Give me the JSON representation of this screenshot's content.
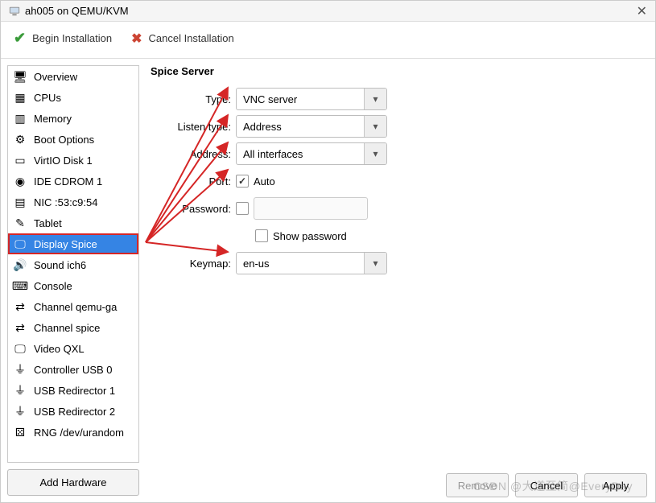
{
  "window": {
    "title": "ah005 on QEMU/KVM"
  },
  "toolbar": {
    "begin_label": "Begin Installation",
    "cancel_label": "Cancel Installation"
  },
  "sidebar": {
    "items": [
      {
        "label": "Overview",
        "icon": "monitor-icon"
      },
      {
        "label": "CPUs",
        "icon": "cpu-icon"
      },
      {
        "label": "Memory",
        "icon": "memory-icon"
      },
      {
        "label": "Boot Options",
        "icon": "boot-icon"
      },
      {
        "label": "VirtIO Disk 1",
        "icon": "disk-icon"
      },
      {
        "label": "IDE CDROM 1",
        "icon": "cdrom-icon"
      },
      {
        "label": "NIC :53:c9:54",
        "icon": "nic-icon"
      },
      {
        "label": "Tablet",
        "icon": "tablet-icon"
      },
      {
        "label": "Display Spice",
        "icon": "display-icon",
        "selected": true
      },
      {
        "label": "Sound ich6",
        "icon": "sound-icon"
      },
      {
        "label": "Console",
        "icon": "console-icon"
      },
      {
        "label": "Channel qemu-ga",
        "icon": "channel-icon"
      },
      {
        "label": "Channel spice",
        "icon": "channel-icon"
      },
      {
        "label": "Video QXL",
        "icon": "video-icon"
      },
      {
        "label": "Controller USB 0",
        "icon": "usb-controller-icon"
      },
      {
        "label": "USB Redirector 1",
        "icon": "usb-icon"
      },
      {
        "label": "USB Redirector 2",
        "icon": "usb-icon"
      },
      {
        "label": "RNG /dev/urandom",
        "icon": "rng-icon"
      }
    ],
    "add_hardware_label": "Add Hardware"
  },
  "panel": {
    "title": "Spice Server",
    "type_label": "Type:",
    "type_value": "VNC server",
    "listen_label": "Listen type:",
    "listen_value": "Address",
    "address_label": "Address:",
    "address_value": "All interfaces",
    "port_label": "Port:",
    "port_checkbox": "Auto",
    "port_checked": true,
    "password_label": "Password:",
    "password_checked": false,
    "show_password_label": "Show password",
    "show_password_checked": false,
    "keymap_label": "Keymap:",
    "keymap_value": "en-us"
  },
  "footer": {
    "remove_label": "Remove",
    "cancel_label": "Cancel",
    "apply_label": "Apply",
    "remove_disabled": true
  },
  "watermark": "CSDN @大道至简@EveryDay",
  "colors": {
    "selection": "#3584e4",
    "annotation_red": "#d52626"
  }
}
